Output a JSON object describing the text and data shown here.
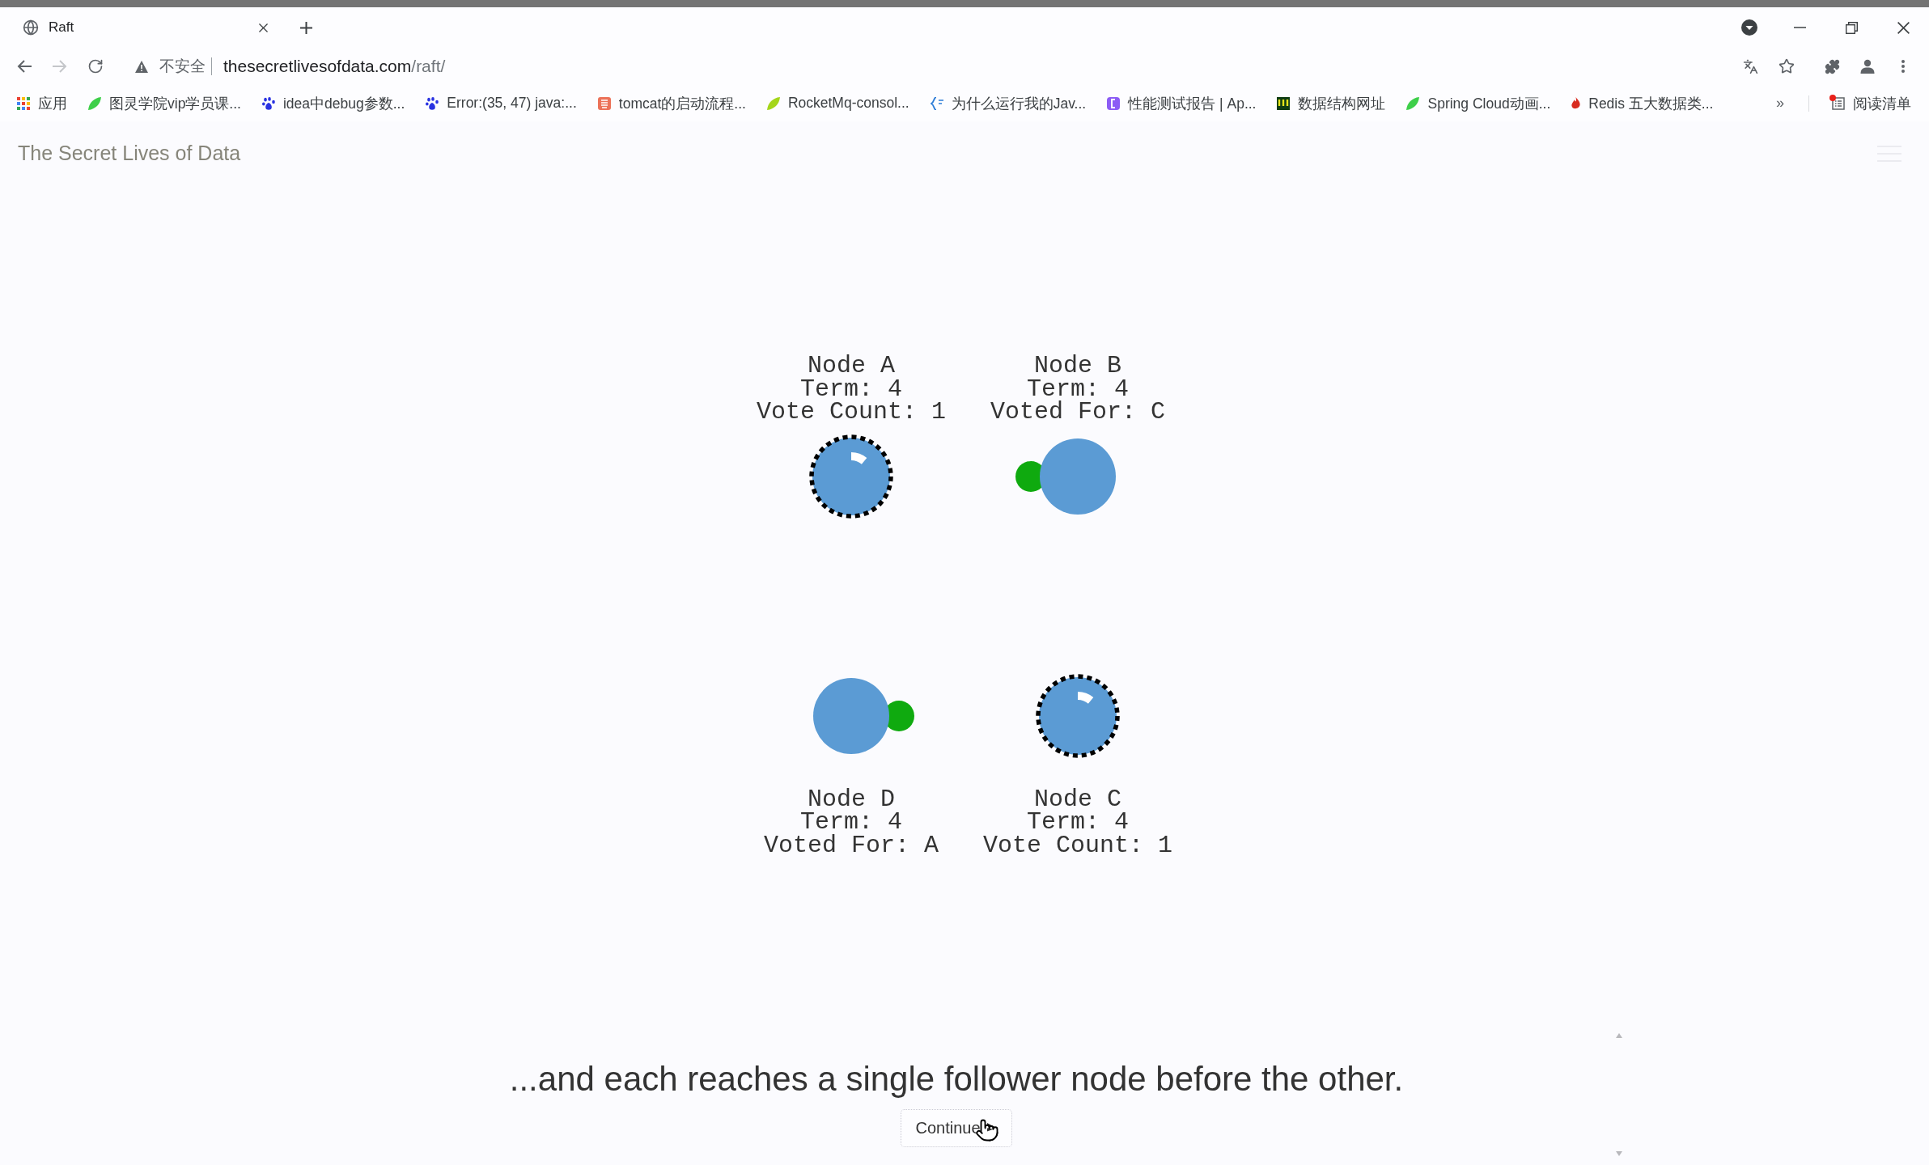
{
  "browser": {
    "tabs": [
      {
        "title": "Raft",
        "selected": true
      }
    ],
    "navigation": {
      "back_disabled": false,
      "forward_disabled": true
    },
    "address_bar": {
      "security_label": "不安全",
      "host": "thesecretlivesofdata.com",
      "path": "/raft/"
    },
    "bookmarks": [
      {
        "label": "应用"
      },
      {
        "label": "图灵学院vip学员课..."
      },
      {
        "label": "idea中debug参数..."
      },
      {
        "label": "Error:(35, 47) java:..."
      },
      {
        "label": "tomcat的启动流程..."
      },
      {
        "label": "RocketMq-consol..."
      },
      {
        "label": "为什么运行我的Jav..."
      },
      {
        "label": "性能测试报告 | Ap..."
      },
      {
        "label": "数据结构网址"
      },
      {
        "label": "Spring Cloud动画..."
      },
      {
        "label": "Redis 五大数据类..."
      }
    ],
    "bookmarks_overflow": "»",
    "reading_list": {
      "label": "阅读清单",
      "unread": true
    }
  },
  "page": {
    "site_title": "The Secret Lives of Data",
    "nodes": [
      {
        "name": "Node A",
        "term": "Term: 4",
        "detail": "Vote Count: 1",
        "kind": "candidate",
        "message_left": false,
        "message_right": false
      },
      {
        "name": "Node B",
        "term": "Term: 4",
        "detail": "Voted For: C",
        "kind": "follower",
        "message_left": true,
        "message_right": false
      },
      {
        "name": "Node D",
        "term": "Term: 4",
        "detail": "Voted For: A",
        "kind": "follower",
        "message_left": false,
        "message_right": true
      },
      {
        "name": "Node C",
        "term": "Term: 4",
        "detail": "Vote Count: 1",
        "kind": "candidate",
        "message_left": false,
        "message_right": false
      }
    ],
    "caption": "...and each reaches a single follower node before the other.",
    "continue_button": "Continue"
  }
}
